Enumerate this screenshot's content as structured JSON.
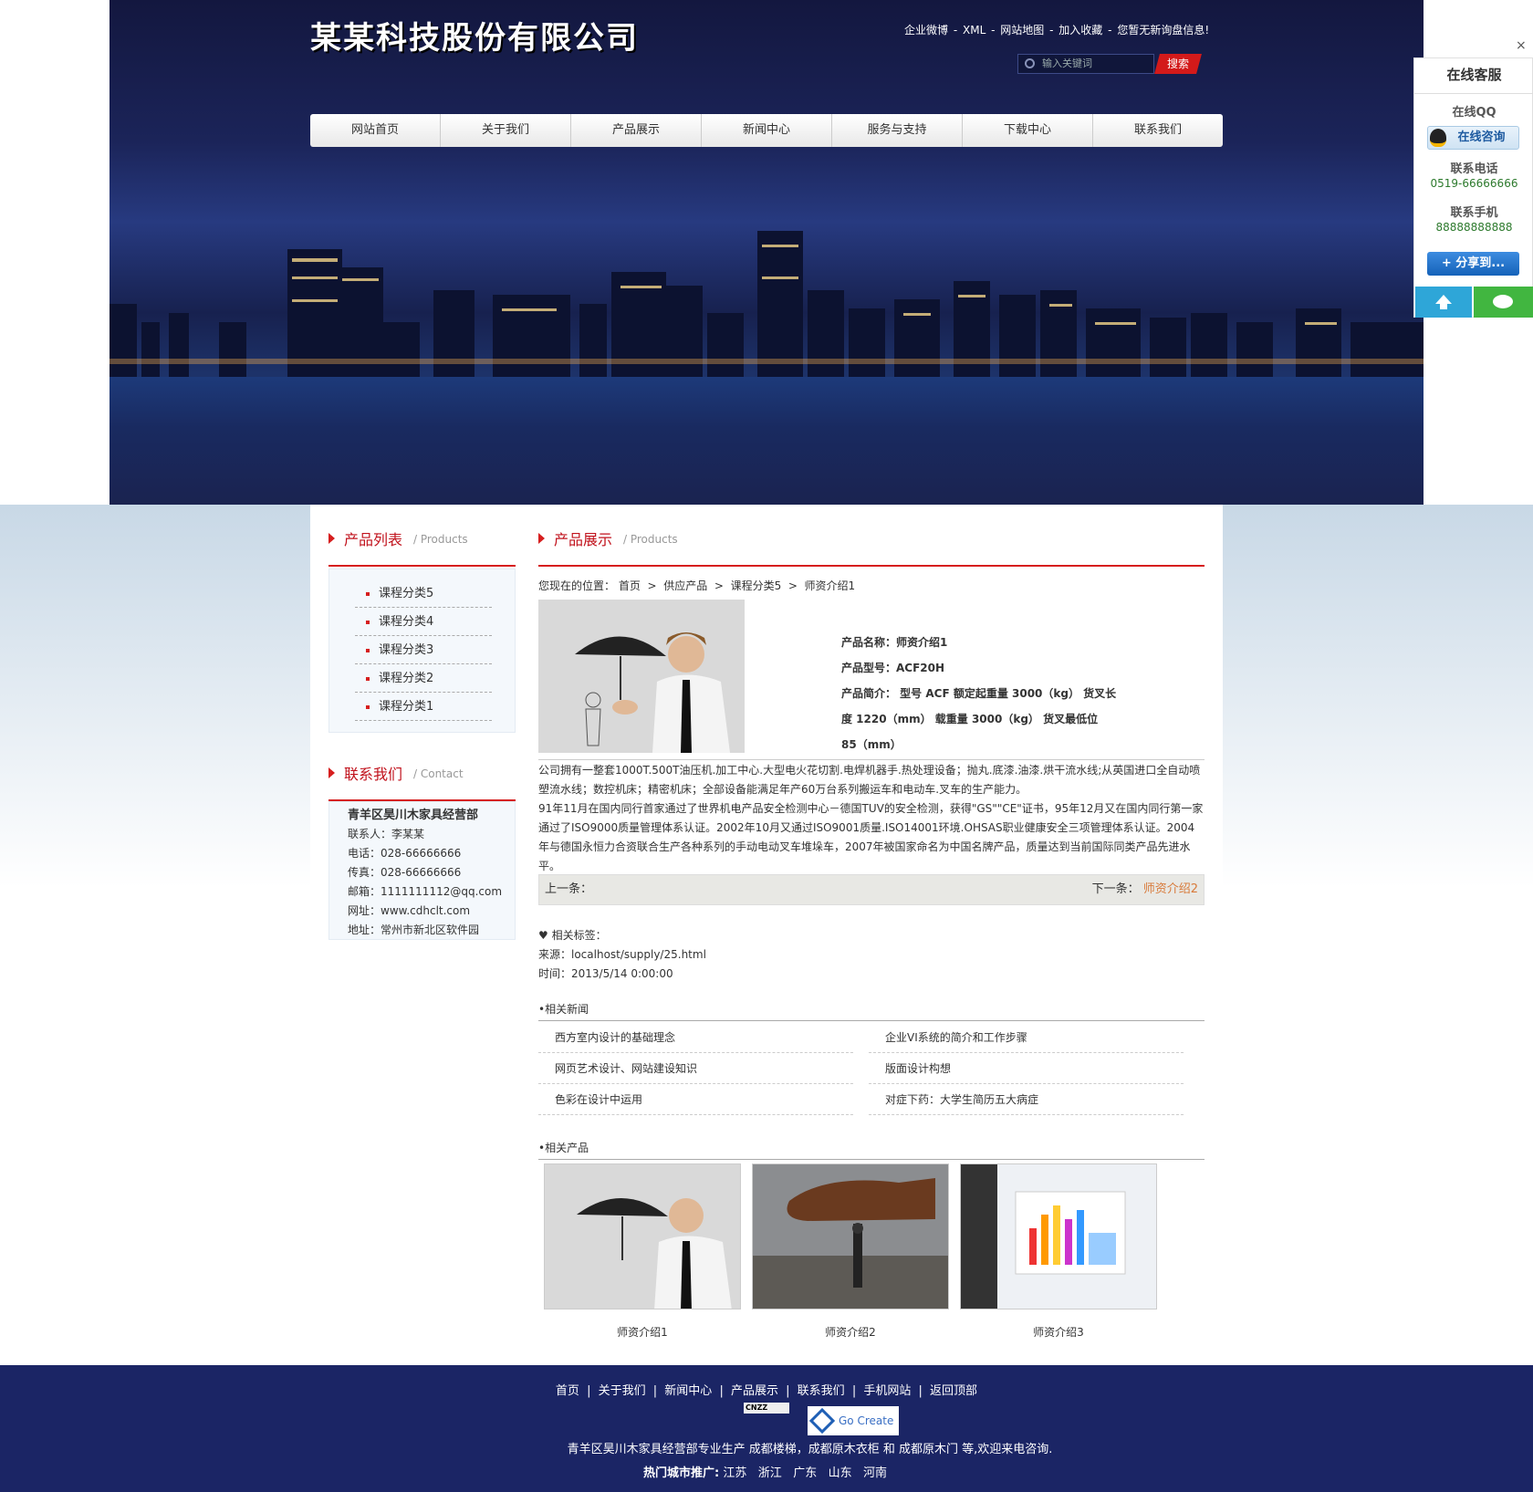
{
  "header": {
    "logo": "某某科技股份有限公司",
    "toplinks": [
      "企业微博",
      "-",
      "XML",
      "-",
      "网站地图",
      "-",
      "加入收藏",
      "-",
      "您暂无新询盘信息!"
    ],
    "search_placeholder": "输入关键词",
    "search_button": "搜索"
  },
  "nav": [
    "网站首页",
    "关于我们",
    "产品展示",
    "新闻中心",
    "服务与支持",
    "下载中心",
    "联系我们"
  ],
  "left": {
    "products_title": "产品列表",
    "products_sub": "/ Products",
    "categories": [
      "课程分类5",
      "课程分类4",
      "课程分类3",
      "课程分类2",
      "课程分类1"
    ],
    "contact_title": "联系我们",
    "contact_sub": "/ Contact",
    "company": "青羊区昊川木家具经营部",
    "contact_lines": [
      "联系人：李某某",
      "电话：028-66666666",
      "传真：028-66666666",
      "邮箱：1111111112@qq.com",
      "网址：www.cdhclt.com",
      "地址：常州市新北区软件园"
    ]
  },
  "right": {
    "title": "产品展示",
    "sub": "/ Products",
    "crumb": {
      "prefix": "您现在的位置：",
      "items": [
        "首页",
        "供应产品",
        "课程分类5",
        "师资介绍1"
      ],
      "sep": ">"
    },
    "product_name": "产品名称：师资介绍1",
    "product_model": "产品型号：ACF20H",
    "product_intro_1": "产品简介： 型号 ACF 额定起重量 3000（kg） 货叉长",
    "product_intro_2": "度 1220（mm） 载重量 3000（kg） 货叉最低位",
    "product_intro_3": "85（mm）",
    "desc": [
      "公司拥有一整套1000T.500T油压机.加工中心.大型电火花切割.电焊机器手.热处理设备；抛丸.底漆.油漆.烘干流水线;从英国进口全自动喷塑流水线；数控机床；精密机床；全部设备能满足年产60万台系列搬运车和电动车.叉车的生产能力。",
      "91年11月在国内同行首家通过了世界机电产品安全检测中心－德国TUV的安全检测，获得\"GS\"\"CE\"证书，95年12月又在国内同行第一家通过了ISO9000质量管理体系认证。2002年10月又通过ISO9001质量.ISO14001环境.OHSAS职业健康安全三项管理体系认证。2004年与德国永恒力合资联合生产各种系列的手动电动叉车堆垛车，2007年被国家命名为中国名牌产品，质量达到当前国际同类产品先进水平。"
    ],
    "prev_label": "上一条：",
    "next_label": "下一条：",
    "next_link": "师资介绍2",
    "tags": "♥ 相关标签：",
    "source": "来源：localhost/supply/25.html",
    "time": "时间：2013/5/14 0:00:00",
    "related_news_title": "•相关新闻",
    "related_news": [
      "西方室内设计的基础理念",
      "企业VI系统的简介和工作步骤",
      "网页艺术设计、网站建设知识",
      "版面设计构想",
      "色彩在设计中运用",
      "对症下药：大学生简历五大病症"
    ],
    "related_products_title": "•相关产品",
    "related_products": [
      "师资介绍1",
      "师资介绍2",
      "师资介绍3"
    ]
  },
  "footer": {
    "links": [
      "首页",
      "|",
      "关于我们",
      "|",
      "新闻中心",
      "|",
      "产品展示",
      "|",
      "联系我们",
      "|",
      "手机网站",
      "|",
      "返回顶部"
    ],
    "cnzz": "CNZZ",
    "badge": "Go Create",
    "line": "青羊区昊川木家具经营部专业生产 成都楼梯，成都原木衣柜 和 成都原木门 等,欢迎来电咨询.",
    "cities_label": "热门城市推广:",
    "cities": [
      "江苏",
      "浙江",
      "广东",
      "山东",
      "河南"
    ]
  },
  "kefu": {
    "close": "×",
    "title": "在线客服",
    "qq_label": "在线QQ",
    "qq_button": "在线咨询",
    "tel_label": "联系电话",
    "tel": "0519-66666666",
    "mobile_label": "联系手机",
    "mobile": "88888888888",
    "share": "+ 分享到..."
  },
  "colors": {
    "accent": "#d61e1e",
    "nav_bg": "#1b2565",
    "link": "#d87a3a"
  }
}
